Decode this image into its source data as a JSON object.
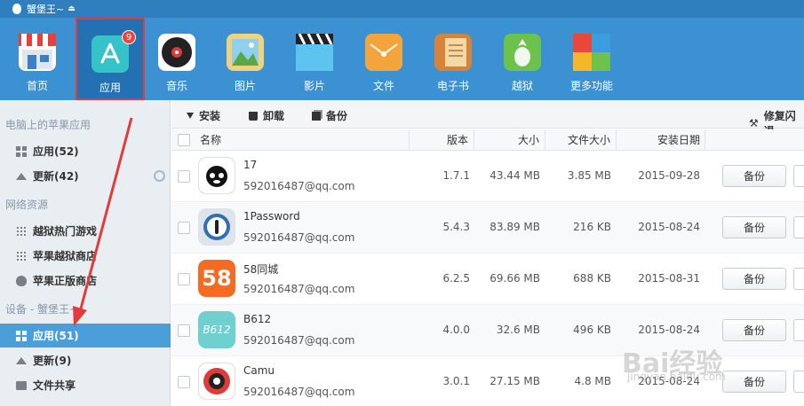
{
  "title_bar": {
    "device_name": "蟹堡王~"
  },
  "toolbar": {
    "items": [
      {
        "label": "首页",
        "icon": "store-icon"
      },
      {
        "label": "应用",
        "icon": "app-store-icon",
        "badge": "9"
      },
      {
        "label": "音乐",
        "icon": "music-disc-icon"
      },
      {
        "label": "图片",
        "icon": "picture-icon"
      },
      {
        "label": "影片",
        "icon": "clapperboard-icon"
      },
      {
        "label": "文件",
        "icon": "envelope-icon"
      },
      {
        "label": "电子书",
        "icon": "book-icon"
      },
      {
        "label": "越狱",
        "icon": "pineapple-icon"
      },
      {
        "label": "更多功能",
        "icon": "grid-icon"
      }
    ]
  },
  "sidebar": {
    "section_pc": "电脑上的苹果应用",
    "pc_apps": "应用(52)",
    "pc_updates": "更新(42)",
    "section_net": "网络资源",
    "net_games": "越狱热门游戏",
    "net_jb_store": "苹果越狱商店",
    "net_store": "苹果正版商店",
    "section_device": "设备 - 蟹堡王~",
    "dev_apps": "应用(51)",
    "dev_updates": "更新(9)",
    "dev_share": "文件共享"
  },
  "actions": {
    "install": "安装",
    "uninstall": "卸载",
    "backup": "备份",
    "repair": "修复闪退"
  },
  "table": {
    "headers": {
      "name": "名称",
      "version": "版本",
      "size": "大小",
      "file_size": "文件大小",
      "install_date": "安装日期"
    },
    "rows": [
      {
        "name": "17",
        "account": "592016487@qq.com",
        "version": "1.7.1",
        "size": "43.44 MB",
        "file_size": "3.85 MB",
        "date": "2015-09-28",
        "action": "备份"
      },
      {
        "name": "1Password",
        "account": "592016487@qq.com",
        "version": "5.4.3",
        "size": "83.89 MB",
        "file_size": "216 KB",
        "date": "2015-08-24",
        "action": "备份"
      },
      {
        "name": "58同城",
        "account": "592016487@qq.com",
        "version": "6.2.5",
        "size": "69.66 MB",
        "file_size": "688 KB",
        "date": "2015-08-31",
        "action": "备份"
      },
      {
        "name": "B612",
        "account": "592016487@qq.com",
        "version": "4.0.0",
        "size": "32.6 MB",
        "file_size": "496 KB",
        "date": "2015-08-24",
        "action": "备份"
      },
      {
        "name": "Camu",
        "account": "592016487@qq.com",
        "version": "3.0.1",
        "size": "27.15 MB",
        "file_size": "4.8 MB",
        "date": "2015-08-24",
        "action": "备份"
      }
    ]
  },
  "app_icons": {
    "icon_58": "58",
    "icon_b612": "B612"
  },
  "watermark": {
    "brand": "Bai经验",
    "url": "jingyan.baidu.com"
  },
  "colors": {
    "toolbar_bg": "#3b91d2",
    "selected": "#4a9fdb",
    "annotation": "#e23b3b"
  }
}
